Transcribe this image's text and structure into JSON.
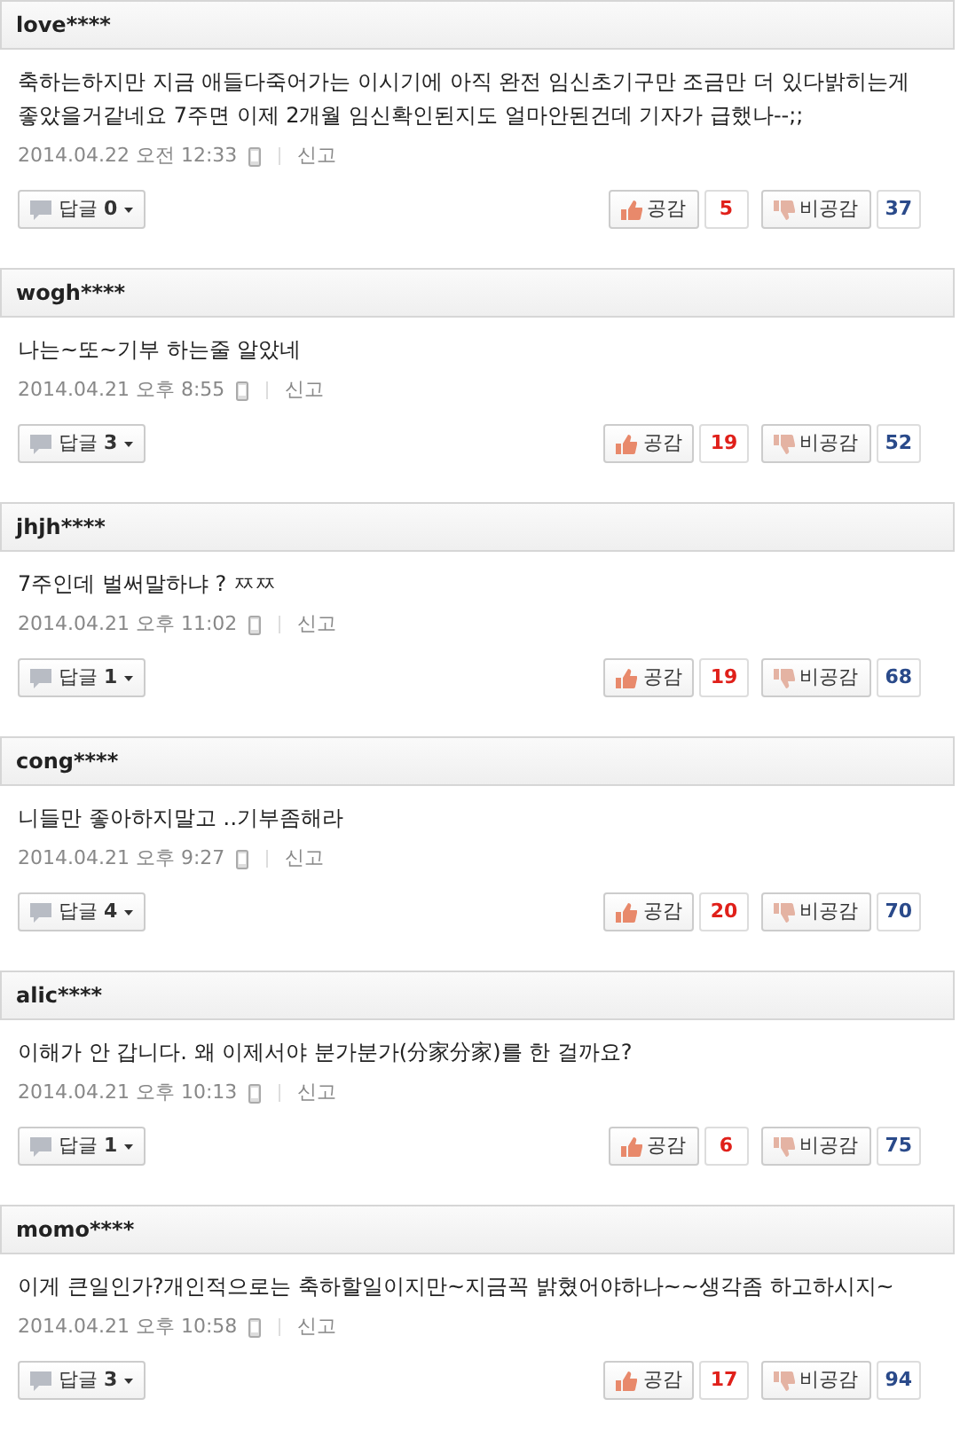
{
  "comments": [
    {
      "author": "love****",
      "text": "축하는하지만 지금 애들다죽어가는 이시기에 아직 완전 임신초기구만 조금만 더 있다밝히는게 좋았을거같네요 7주면 이제 2개월 임신확인된지도 얼마안된건데 기자가 급했나--;;",
      "date": "2014.04.22 오전 12:33",
      "report": "신고",
      "reply_label": "답글",
      "reply_count": "0",
      "like_label": "공감",
      "likes": "5",
      "dislike_label": "비공감",
      "dislikes": "37"
    },
    {
      "author": "wogh****",
      "text": "나는~또~기부 하는줄 알았네",
      "date": "2014.04.21 오후 8:55",
      "report": "신고",
      "reply_label": "답글",
      "reply_count": "3",
      "like_label": "공감",
      "likes": "19",
      "dislike_label": "비공감",
      "dislikes": "52"
    },
    {
      "author": "jhjh****",
      "text": "7주인데 벌써말하냐 ? ㅉㅉ",
      "date": "2014.04.21 오후 11:02",
      "report": "신고",
      "reply_label": "답글",
      "reply_count": "1",
      "like_label": "공감",
      "likes": "19",
      "dislike_label": "비공감",
      "dislikes": "68"
    },
    {
      "author": "cong****",
      "text": "니들만 좋아하지말고 ‥기부좀해라",
      "date": "2014.04.21 오후 9:27",
      "report": "신고",
      "reply_label": "답글",
      "reply_count": "4",
      "like_label": "공감",
      "likes": "20",
      "dislike_label": "비공감",
      "dislikes": "70"
    },
    {
      "author": "alic****",
      "text": "이해가 안 갑니다. 왜 이제서야 분가분가(分家分家)를 한 걸까요?",
      "date": "2014.04.21 오후 10:13",
      "report": "신고",
      "reply_label": "답글",
      "reply_count": "1",
      "like_label": "공감",
      "likes": "6",
      "dislike_label": "비공감",
      "dislikes": "75"
    },
    {
      "author": "momo****",
      "text": "이게 큰일인가?개인적으로는 축하할일이지만~지금꼭 밝혔어야하나~~생각좀 하고하시지~",
      "date": "2014.04.21 오후 10:58",
      "report": "신고",
      "reply_label": "답글",
      "reply_count": "3",
      "like_label": "공감",
      "likes": "17",
      "dislike_label": "비공감",
      "dislikes": "94"
    }
  ]
}
